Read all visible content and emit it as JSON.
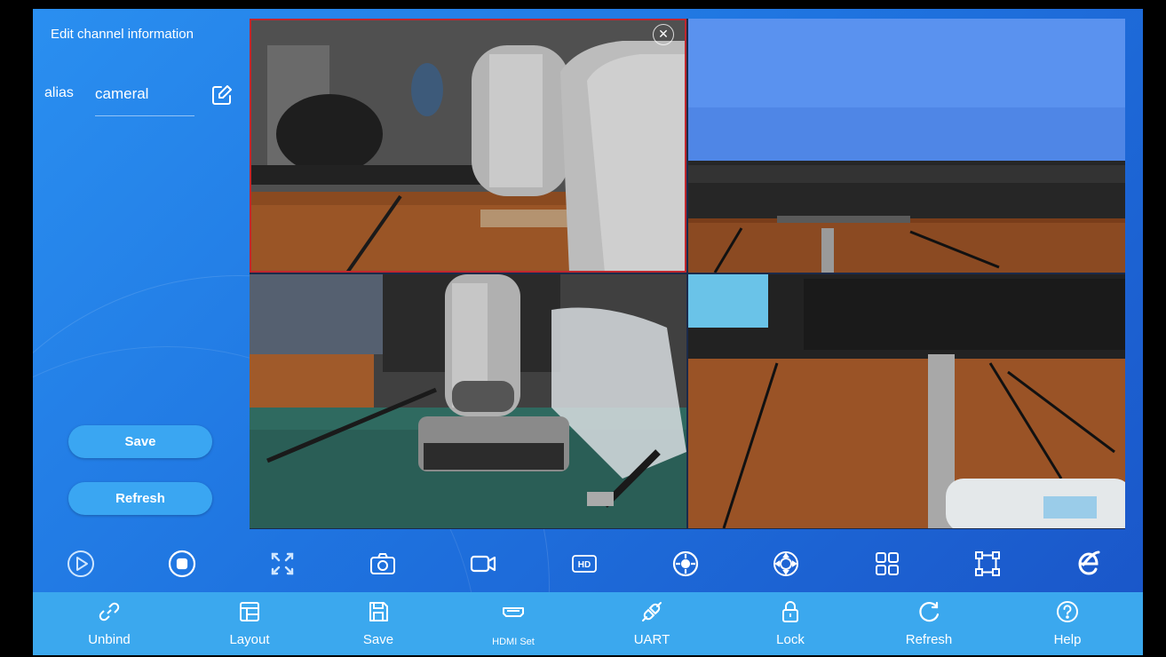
{
  "sidebar": {
    "title": "Edit channel information",
    "alias_label": "alias",
    "alias_value": "cameral",
    "save_label": "Save",
    "refresh_label": "Refresh"
  },
  "video_feeds": [
    {
      "channel": "feed-1",
      "selected": true,
      "close_glyph": "✕"
    },
    {
      "channel": "feed-2",
      "selected": false
    },
    {
      "channel": "feed-3",
      "selected": false
    },
    {
      "channel": "feed-4",
      "selected": false
    }
  ],
  "control_bar": [
    {
      "icon": "play-icon"
    },
    {
      "icon": "stop-icon"
    },
    {
      "icon": "fullscreen-icon"
    },
    {
      "icon": "camera-snapshot-icon"
    },
    {
      "icon": "video-record-icon"
    },
    {
      "icon": "hd-icon"
    },
    {
      "icon": "ptz-control-icon"
    },
    {
      "icon": "direction-pad-icon"
    },
    {
      "icon": "grid-layout-icon"
    },
    {
      "icon": "selection-frame-icon"
    },
    {
      "icon": "browser-e-icon"
    }
  ],
  "bottom_bar": {
    "unbind": "Unbind",
    "layout": "Layout",
    "save": "Save",
    "hdmi": "HDMI Set",
    "uart": "UART",
    "lock": "Lock",
    "refresh": "Refresh",
    "help": "Help"
  },
  "colors": {
    "panel_blue": "#1f74e0",
    "bar_blue": "#3ba8ee",
    "button_blue": "#3aa6f2",
    "selection_red": "#c0272d"
  }
}
